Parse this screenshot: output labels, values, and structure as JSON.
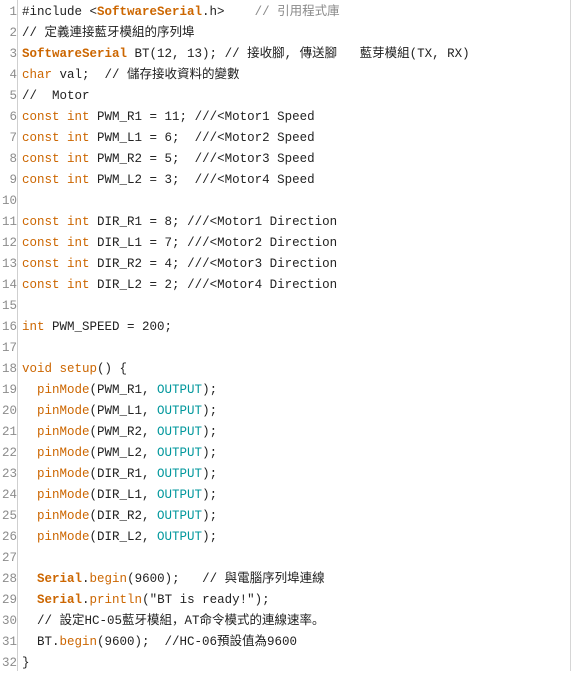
{
  "colors": {
    "keyword": "#cc6600",
    "constant": "#00979c",
    "comment": "#8a8a8a",
    "text": "#222222",
    "line_number": "#8c8c8c",
    "background": "#ffffff"
  },
  "lines": [
    {
      "n": "1",
      "tokens": [
        {
          "t": "#include <",
          "c": "tx"
        },
        {
          "t": "SoftwareSerial",
          "c": "kb"
        },
        {
          "t": ".h>    ",
          "c": "tx"
        },
        {
          "t": "// 引用程式庫",
          "c": "cm"
        }
      ]
    },
    {
      "n": "2",
      "tokens": [
        {
          "t": "// 定義連接藍牙模組的序列埠",
          "c": "tx"
        }
      ]
    },
    {
      "n": "3",
      "tokens": [
        {
          "t": "SoftwareSerial",
          "c": "kb"
        },
        {
          "t": " BT(12, 13); ",
          "c": "tx"
        },
        {
          "t": "// 接收腳, 傳送腳   藍芽模組(TX, RX)",
          "c": "tx"
        }
      ]
    },
    {
      "n": "4",
      "tokens": [
        {
          "t": "char",
          "c": "kw"
        },
        {
          "t": " val;  ",
          "c": "tx"
        },
        {
          "t": "// 儲存接收資料的變數",
          "c": "tx"
        }
      ]
    },
    {
      "n": "5",
      "tokens": [
        {
          "t": "//  Motor",
          "c": "tx"
        }
      ]
    },
    {
      "n": "6",
      "tokens": [
        {
          "t": "const",
          "c": "kw"
        },
        {
          "t": " ",
          "c": "tx"
        },
        {
          "t": "int",
          "c": "kw"
        },
        {
          "t": " PWM_R1 = 11; ///<Motor1 Speed",
          "c": "tx"
        }
      ]
    },
    {
      "n": "7",
      "tokens": [
        {
          "t": "const",
          "c": "kw"
        },
        {
          "t": " ",
          "c": "tx"
        },
        {
          "t": "int",
          "c": "kw"
        },
        {
          "t": " PWM_L1 = 6;  ///<Motor2 Speed",
          "c": "tx"
        }
      ]
    },
    {
      "n": "8",
      "tokens": [
        {
          "t": "const",
          "c": "kw"
        },
        {
          "t": " ",
          "c": "tx"
        },
        {
          "t": "int",
          "c": "kw"
        },
        {
          "t": " PWM_R2 = 5;  ///<Motor3 Speed",
          "c": "tx"
        }
      ]
    },
    {
      "n": "9",
      "tokens": [
        {
          "t": "const",
          "c": "kw"
        },
        {
          "t": " ",
          "c": "tx"
        },
        {
          "t": "int",
          "c": "kw"
        },
        {
          "t": " PWM_L2 = 3;  ///<Motor4 Speed",
          "c": "tx"
        }
      ]
    },
    {
      "n": "10",
      "tokens": []
    },
    {
      "n": "11",
      "tokens": [
        {
          "t": "const",
          "c": "kw"
        },
        {
          "t": " ",
          "c": "tx"
        },
        {
          "t": "int",
          "c": "kw"
        },
        {
          "t": " DIR_R1 = 8; ///<Motor1 Direction",
          "c": "tx"
        }
      ]
    },
    {
      "n": "12",
      "tokens": [
        {
          "t": "const",
          "c": "kw"
        },
        {
          "t": " ",
          "c": "tx"
        },
        {
          "t": "int",
          "c": "kw"
        },
        {
          "t": " DIR_L1 = 7; ///<Motor2 Direction",
          "c": "tx"
        }
      ]
    },
    {
      "n": "13",
      "tokens": [
        {
          "t": "const",
          "c": "kw"
        },
        {
          "t": " ",
          "c": "tx"
        },
        {
          "t": "int",
          "c": "kw"
        },
        {
          "t": " DIR_R2 = 4; ///<Motor3 Direction",
          "c": "tx"
        }
      ]
    },
    {
      "n": "14",
      "tokens": [
        {
          "t": "const",
          "c": "kw"
        },
        {
          "t": " ",
          "c": "tx"
        },
        {
          "t": "int",
          "c": "kw"
        },
        {
          "t": " DIR_L2 = 2; ///<Motor4 Direction",
          "c": "tx"
        }
      ]
    },
    {
      "n": "15",
      "tokens": []
    },
    {
      "n": "16",
      "tokens": [
        {
          "t": "int",
          "c": "kw"
        },
        {
          "t": " PWM_SPEED = 200;",
          "c": "tx"
        }
      ]
    },
    {
      "n": "17",
      "tokens": []
    },
    {
      "n": "18",
      "tokens": [
        {
          "t": "void",
          "c": "kw"
        },
        {
          "t": " ",
          "c": "tx"
        },
        {
          "t": "setup",
          "c": "kw"
        },
        {
          "t": "() {",
          "c": "tx"
        }
      ]
    },
    {
      "n": "19",
      "tokens": [
        {
          "t": "  ",
          "c": "tx"
        },
        {
          "t": "pinMode",
          "c": "kw"
        },
        {
          "t": "(PWM_R1, ",
          "c": "tx"
        },
        {
          "t": "OUTPUT",
          "c": "cn"
        },
        {
          "t": ");",
          "c": "tx"
        }
      ]
    },
    {
      "n": "20",
      "tokens": [
        {
          "t": "  ",
          "c": "tx"
        },
        {
          "t": "pinMode",
          "c": "kw"
        },
        {
          "t": "(PWM_L1, ",
          "c": "tx"
        },
        {
          "t": "OUTPUT",
          "c": "cn"
        },
        {
          "t": ");",
          "c": "tx"
        }
      ]
    },
    {
      "n": "21",
      "tokens": [
        {
          "t": "  ",
          "c": "tx"
        },
        {
          "t": "pinMode",
          "c": "kw"
        },
        {
          "t": "(PWM_R2, ",
          "c": "tx"
        },
        {
          "t": "OUTPUT",
          "c": "cn"
        },
        {
          "t": ");",
          "c": "tx"
        }
      ]
    },
    {
      "n": "22",
      "tokens": [
        {
          "t": "  ",
          "c": "tx"
        },
        {
          "t": "pinMode",
          "c": "kw"
        },
        {
          "t": "(PWM_L2, ",
          "c": "tx"
        },
        {
          "t": "OUTPUT",
          "c": "cn"
        },
        {
          "t": ");",
          "c": "tx"
        }
      ]
    },
    {
      "n": "23",
      "tokens": [
        {
          "t": "  ",
          "c": "tx"
        },
        {
          "t": "pinMode",
          "c": "kw"
        },
        {
          "t": "(DIR_R1, ",
          "c": "tx"
        },
        {
          "t": "OUTPUT",
          "c": "cn"
        },
        {
          "t": ");",
          "c": "tx"
        }
      ]
    },
    {
      "n": "24",
      "tokens": [
        {
          "t": "  ",
          "c": "tx"
        },
        {
          "t": "pinMode",
          "c": "kw"
        },
        {
          "t": "(DIR_L1, ",
          "c": "tx"
        },
        {
          "t": "OUTPUT",
          "c": "cn"
        },
        {
          "t": ");",
          "c": "tx"
        }
      ]
    },
    {
      "n": "25",
      "tokens": [
        {
          "t": "  ",
          "c": "tx"
        },
        {
          "t": "pinMode",
          "c": "kw"
        },
        {
          "t": "(DIR_R2, ",
          "c": "tx"
        },
        {
          "t": "OUTPUT",
          "c": "cn"
        },
        {
          "t": ");",
          "c": "tx"
        }
      ]
    },
    {
      "n": "26",
      "tokens": [
        {
          "t": "  ",
          "c": "tx"
        },
        {
          "t": "pinMode",
          "c": "kw"
        },
        {
          "t": "(DIR_L2, ",
          "c": "tx"
        },
        {
          "t": "OUTPUT",
          "c": "cn"
        },
        {
          "t": ");",
          "c": "tx"
        }
      ]
    },
    {
      "n": "27",
      "tokens": []
    },
    {
      "n": "28",
      "tokens": [
        {
          "t": "  ",
          "c": "tx"
        },
        {
          "t": "Serial",
          "c": "kb"
        },
        {
          "t": ".",
          "c": "tx"
        },
        {
          "t": "begin",
          "c": "kw"
        },
        {
          "t": "(9600);   ",
          "c": "tx"
        },
        {
          "t": "// 與電腦序列埠連線",
          "c": "tx"
        }
      ]
    },
    {
      "n": "29",
      "tokens": [
        {
          "t": "  ",
          "c": "tx"
        },
        {
          "t": "Serial",
          "c": "kb"
        },
        {
          "t": ".",
          "c": "tx"
        },
        {
          "t": "println",
          "c": "kw"
        },
        {
          "t": "(\"BT is ready!\");",
          "c": "tx"
        }
      ]
    },
    {
      "n": "30",
      "tokens": [
        {
          "t": "  ",
          "c": "tx"
        },
        {
          "t": "// 設定HC-05藍牙模組，AT命令模式的連線速率。",
          "c": "tx"
        }
      ]
    },
    {
      "n": "31",
      "tokens": [
        {
          "t": "  BT.",
          "c": "tx"
        },
        {
          "t": "begin",
          "c": "kw"
        },
        {
          "t": "(9600);  ",
          "c": "tx"
        },
        {
          "t": "//HC-06預設值為9600",
          "c": "tx"
        }
      ]
    },
    {
      "n": "32",
      "tokens": [
        {
          "t": "}",
          "c": "tx"
        }
      ]
    }
  ]
}
